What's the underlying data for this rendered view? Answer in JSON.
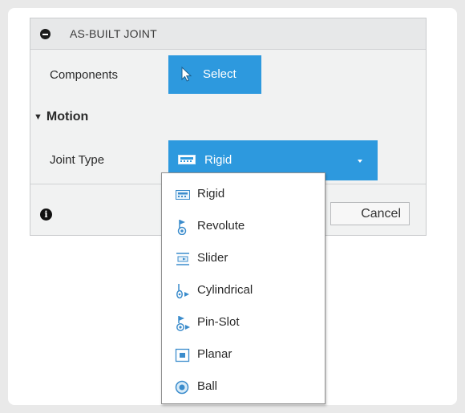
{
  "panel": {
    "title": "AS-BUILT JOINT",
    "components_label": "Components",
    "select_label": "Select",
    "motion_label": "Motion",
    "joint_type_label": "Joint Type",
    "joint_type_value": "Rigid",
    "cancel_label": "Cancel"
  },
  "menu": {
    "items": [
      {
        "label": "Rigid",
        "icon": "rigid-joint-icon"
      },
      {
        "label": "Revolute",
        "icon": "revolute-joint-icon"
      },
      {
        "label": "Slider",
        "icon": "slider-joint-icon"
      },
      {
        "label": "Cylindrical",
        "icon": "cylindrical-joint-icon"
      },
      {
        "label": "Pin-Slot",
        "icon": "pin-slot-joint-icon"
      },
      {
        "label": "Planar",
        "icon": "planar-joint-icon"
      },
      {
        "label": "Ball",
        "icon": "ball-joint-icon"
      }
    ]
  },
  "colors": {
    "accent": "#2d99de",
    "panel_bg": "#f1f2f2"
  }
}
